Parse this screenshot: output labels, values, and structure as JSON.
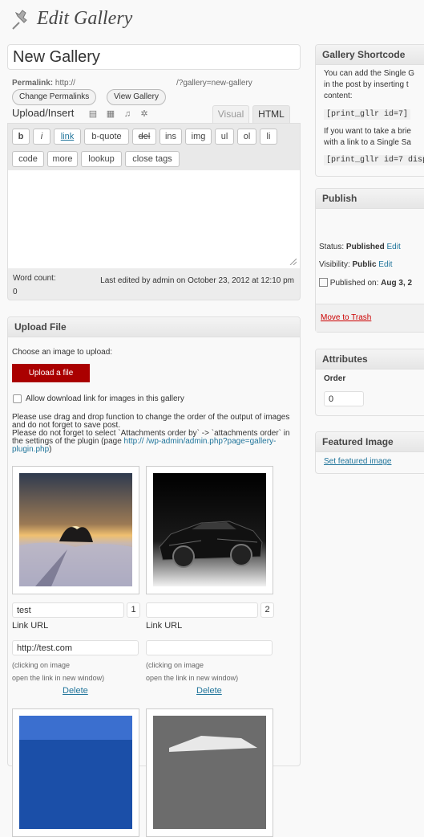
{
  "page": {
    "title": "Edit Gallery"
  },
  "post": {
    "title_value": "New Gallery"
  },
  "permalink": {
    "label": "Permalink:",
    "prefix": "http://",
    "suffix": "/?gallery=new-gallery",
    "change_button": "Change Permalinks",
    "view_button": "View Gallery"
  },
  "editor": {
    "upload_insert_label": "Upload/Insert",
    "media_icons": [
      "image-icon",
      "video-icon",
      "audio-icon",
      "media-gear-icon"
    ],
    "tabs": {
      "visual": "Visual",
      "html": "HTML"
    },
    "quicktags_row1": [
      "b",
      "i",
      "link",
      "b-quote",
      "del",
      "ins",
      "img",
      "ul",
      "ol",
      "li"
    ],
    "quicktags_row2": [
      "code",
      "more",
      "lookup",
      "close tags"
    ],
    "word_count_label": "Word count:",
    "word_count": "0",
    "last_edited": "Last edited by admin on October 23, 2012 at 12:10 pm"
  },
  "upload_box": {
    "title": "Upload File",
    "choose_text": "Choose an image to upload:",
    "upload_button": "Upload a file",
    "allow_download_label": "Allow download link for images in this gallery",
    "info_line1": "Please use drag and drop function to change the order of the output of images and do not forget to save post.",
    "info_line2": "Please do not forget to select `Attachments order by` -> `attachments order` in the settings of the plugin (page",
    "info_link_a": "http://",
    "info_link_b": "/wp-admin/admin.php?page=gallery-plugin.php",
    "info_close": ")",
    "images": [
      {
        "title": "test",
        "order": "1",
        "link_label": "Link URL",
        "link_url": "http://test.com",
        "hint1": "(clicking on image",
        "hint2": "open the link in new window)",
        "delete": "Delete"
      },
      {
        "title": "",
        "order": "2",
        "link_label": "Link URL",
        "link_url": "",
        "hint1": "(clicking on image",
        "hint2": "open the link in new window)",
        "delete": "Delete"
      }
    ]
  },
  "shortcode_box": {
    "title": "Gallery Shortcode",
    "text1a": "You can add the Single G",
    "text1b": "in the post by inserting t",
    "text1c": "content:",
    "code1": "[print_gllr id=7]",
    "text2a": "If you want to take a brie",
    "text2b": "with a link to a Single Sa",
    "code2": "[print_gllr id=7 displ"
  },
  "publish_box": {
    "title": "Publish",
    "status_label": "Status:",
    "status_value": "Published",
    "status_edit": "Edit",
    "visibility_label": "Visibility:",
    "visibility_value": "Public",
    "visibility_edit": "Edit",
    "published_label": "Published on:",
    "published_value": "Aug 3, 2",
    "trash": "Move to Trash"
  },
  "attributes_box": {
    "title": "Attributes",
    "order_label": "Order",
    "order_value": "0"
  },
  "featured_box": {
    "title": "Featured Image",
    "link": "Set featured image"
  }
}
